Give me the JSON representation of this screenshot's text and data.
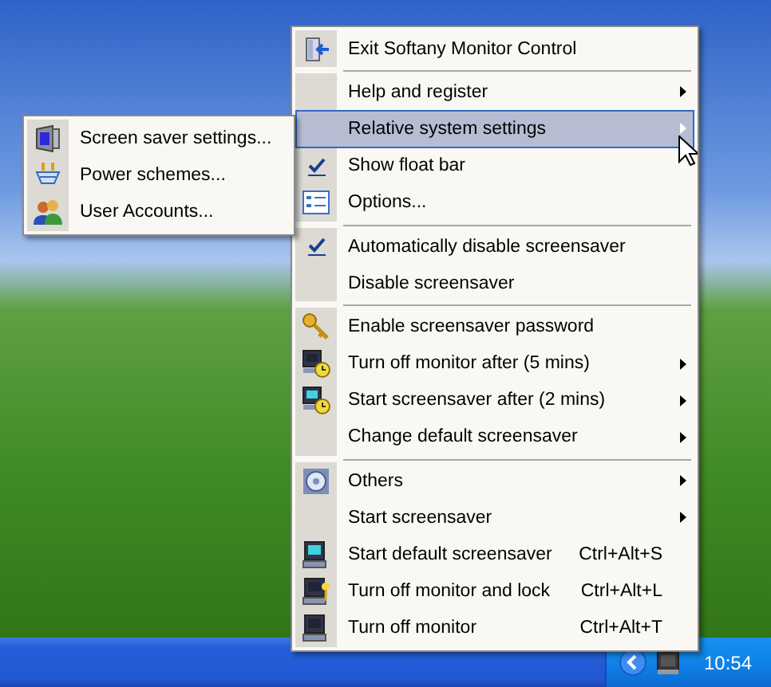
{
  "main_menu": {
    "sections": [
      [
        {
          "kind": "exit",
          "label": "Exit Softany Monitor Control",
          "selected": false
        }
      ],
      [
        {
          "kind": "plain",
          "label": "Help and register",
          "submenu": true,
          "selected": false
        },
        {
          "kind": "plain",
          "label": "Relative system settings",
          "submenu": true,
          "selected": true
        },
        {
          "kind": "check",
          "label": "Show float bar",
          "checked": true,
          "selected": false
        },
        {
          "kind": "options",
          "label": "Options...",
          "selected": false
        }
      ],
      [
        {
          "kind": "check",
          "label": "Automatically disable screensaver",
          "checked": true,
          "selected": false
        },
        {
          "kind": "plain",
          "label": "Disable screensaver",
          "selected": false
        }
      ],
      [
        {
          "kind": "key",
          "label": "Enable screensaver password",
          "selected": false
        },
        {
          "kind": "monitor-clock",
          "label": "Turn off monitor after (5 mins)",
          "submenu": true,
          "selected": false
        },
        {
          "kind": "screen-clock",
          "label": "Start screensaver after (2 mins)",
          "submenu": true,
          "selected": false
        },
        {
          "kind": "plain",
          "label": "Change default screensaver",
          "submenu": true,
          "selected": false
        }
      ],
      [
        {
          "kind": "disc",
          "label": "Others",
          "submenu": true,
          "selected": false
        },
        {
          "kind": "plain",
          "label": "Start screensaver",
          "submenu": true,
          "selected": false
        },
        {
          "kind": "screen",
          "label": "Start default screensaver",
          "shortcut": "Ctrl+Alt+S",
          "selected": false
        },
        {
          "kind": "monitor-key",
          "label": "Turn off monitor and lock",
          "shortcut": "Ctrl+Alt+L",
          "selected": false
        },
        {
          "kind": "monitor",
          "label": "Turn off monitor",
          "shortcut": "Ctrl+Alt+T",
          "selected": false
        }
      ]
    ]
  },
  "submenu": {
    "items": [
      {
        "kind": "screensaver",
        "label": "Screen saver settings..."
      },
      {
        "kind": "power",
        "label": "Power schemes..."
      },
      {
        "kind": "users",
        "label": "User Accounts..."
      }
    ]
  },
  "taskbar": {
    "clock": "10:54"
  }
}
